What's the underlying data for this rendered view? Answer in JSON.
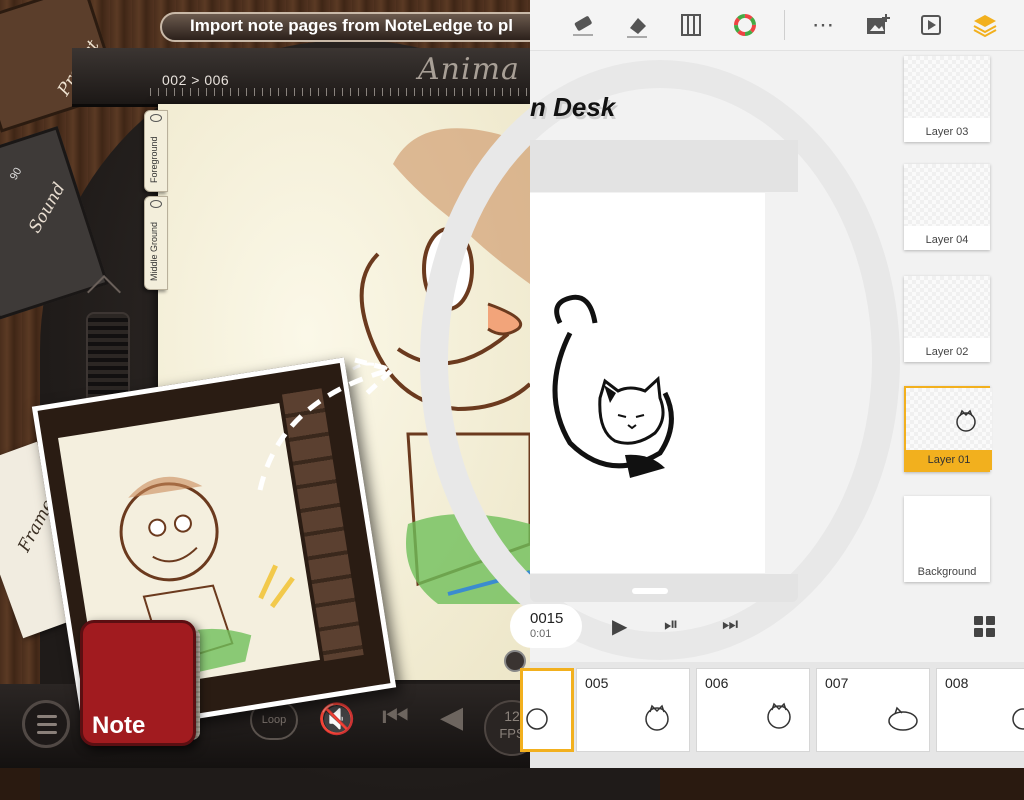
{
  "banner": {
    "text": "Import note pages from NoteLedge to pl"
  },
  "left_panel": {
    "app_title": "Anima",
    "frame_range": "002 > 006",
    "layers": [
      "Foreground",
      "Middle Ground"
    ],
    "cassettes": {
      "project": "Project",
      "sound": "Sound",
      "sound_number": "90",
      "frames": "Frames"
    },
    "loop_label": "Loop",
    "fps": {
      "value": "12",
      "unit": "FPS"
    },
    "note_app_label": "Note"
  },
  "right_panel": {
    "brand_text": "n Desk",
    "frame_counter": {
      "frame": "0015",
      "time": "0:01"
    },
    "layers": [
      {
        "name": "Layer 03",
        "active": false
      },
      {
        "name": "Layer 04",
        "active": false
      },
      {
        "name": "Layer 02",
        "active": false
      },
      {
        "name": "Layer 01",
        "active": true
      },
      {
        "name": "Background",
        "active": false
      }
    ],
    "frames": [
      "005",
      "006",
      "007",
      "008"
    ],
    "toolbar_icons": [
      "eraser-icon",
      "fill-icon",
      "ruler-icon",
      "color-wheel-icon",
      "more-icon",
      "add-image-icon",
      "playback-icon",
      "layers-icon"
    ],
    "colors": {
      "accent": "#f2b01e"
    }
  }
}
